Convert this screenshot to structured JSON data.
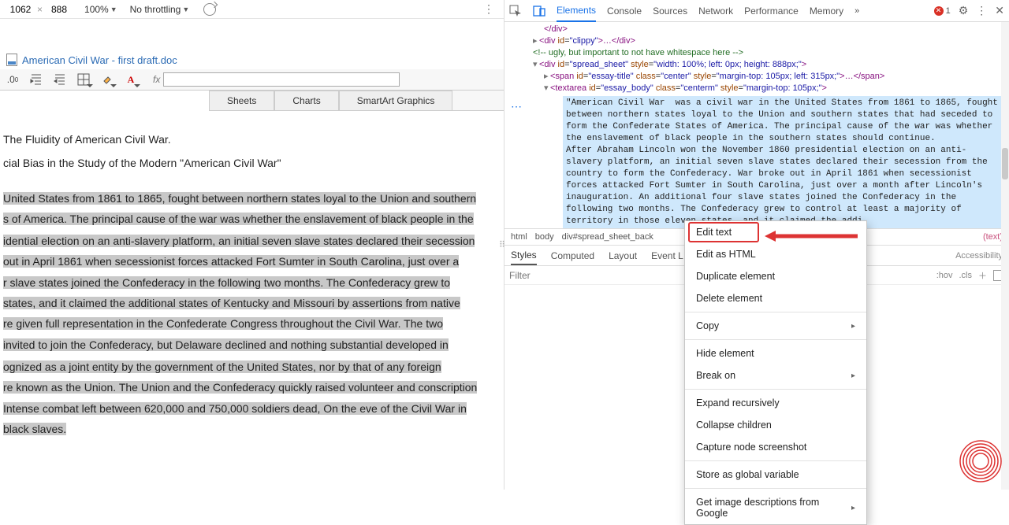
{
  "top": {
    "width": "1062",
    "height": "888",
    "zoom": "100%",
    "throttle": "No throttling"
  },
  "doc": {
    "filename": "American Civil War - first draft.doc",
    "fx": "fx",
    "tabs": {
      "sheets": "Sheets",
      "charts": "Charts",
      "smartart": "SmartArt Graphics"
    },
    "p1": "The Fluidity of American Civil War.",
    "p2": "cial Bias in the Study of the Modern \"American Civil War\"",
    "s1": "United States from 1861 to 1865, fought between northern states loyal to the Union and southern",
    "s2": "s of America. The principal cause of the war was whether the enslavement of black people in the",
    "s3": "idential election on an anti-slavery platform, an initial seven slave states declared their secession",
    "s4": " out in April 1861 when secessionist forces attacked Fort Sumter in South Carolina, just over a",
    "s5": "r slave states joined the Confederacy in the following two months. The Confederacy grew to",
    "s6": "states, and it claimed the additional states of Kentucky and Missouri by assertions from native",
    "s7": "re given full representation in the Confederate Congress throughout the Civil War. The two",
    "s8": " invited to join the Confederacy, but Delaware declined and nothing substantial developed in",
    "s9": "ognized as a joint entity by the government of the United States, nor by that of any foreign",
    "s10": "re known as the Union. The Union and the Confederacy quickly raised volunteer and conscription",
    "s11": " Intense combat left between 620,000 and 750,000 soldiers dead, On the eve of the Civil War in",
    "s12": "black slaves."
  },
  "devtools": {
    "tabs": {
      "elements": "Elements",
      "console": "Console",
      "sources": "Sources",
      "network": "Network",
      "performance": "Performance",
      "memory": "Memory"
    },
    "errcount": "1",
    "lines": {
      "l1": "</div>",
      "l2a": "<div ",
      "l2id": "id",
      "l2idv": "\"clippy\"",
      "l2b": ">…</div>",
      "l3": "<!-- ugly, but important to not have whitespace here -->",
      "l4a": "<div ",
      "l4id": "id",
      "l4idv": "\"spread_sheet\"",
      "l4st": "style",
      "l4stv": "\"width: 100%; left: 0px; height: 888px;\"",
      "l4b": ">",
      "l5a": "<span ",
      "l5id": "id",
      "l5idv": "\"essay-title\"",
      "l5cl": "class",
      "l5clv": "\"center\"",
      "l5st": "style",
      "l5stv": "\"margin-top: 105px; left: 315px;\"",
      "l5b": ">…</span>",
      "l6a": "<textarea ",
      "l6id": "id",
      "l6idv": "\"essay_body\"",
      "l6cl": "class",
      "l6clv": "\"centerm\"",
      "l6st": "style",
      "l6stv": "\"margin-top: 105px;\"",
      "l6b": ">"
    },
    "textarea_content": "\"American Civil War  was a civil war in the United States from 1861 to 1865, fought between northern states loyal to the Union and southern states that had seceded to form the Confederate States of America. The principal cause of the war was whether the enslavement of black people in the southern states should continue.\nAfter Abraham Lincoln won the November 1860 presidential election on an anti-slavery platform, an initial seven slave states declared their secession from the country to form the Confederacy. War broke out in April 1861 when secessionist forces attacked Fort Sumter in South Carolina, just over a month after Lincoln's inauguration. An additional four slave states joined the Confederacy in the following two months. The Confederacy grew to control at least a majority of territory in those eleven states, and it claimed the addi                               by assertions from native secessionists fleeing U                                full representation in the Confederate Congres                               aining slave states, Delaware and Maryland,                                ut Delaware declined and nothing substantial dev                                by federal troops.\nThe Confederate states                                a joint entity by the government of the Unite                               untry. The states that remained loyal to the U                                and the Confederacy quickly raised voluntee                               stly in the South for",
    "crumbs": {
      "html": "html",
      "body": "body",
      "div": "div#spread_sheet_back",
      "text": "(text)"
    },
    "styles": {
      "styles": "Styles",
      "computed": "Computed",
      "layout": "Layout",
      "event": "Event L",
      "access": "Accessibility",
      "hov": ":hov",
      "cls": ".cls"
    },
    "filter": "Filter"
  },
  "ctx": {
    "edit_text": "Edit text",
    "edit_html": "Edit as HTML",
    "dup": "Duplicate element",
    "del": "Delete element",
    "copy": "Copy",
    "hide": "Hide element",
    "breakon": "Break on",
    "expand": "Expand recursively",
    "collapse": "Collapse children",
    "capture": "Capture node screenshot",
    "store": "Store as global variable",
    "imgdesc": "Get image descriptions from Google"
  }
}
